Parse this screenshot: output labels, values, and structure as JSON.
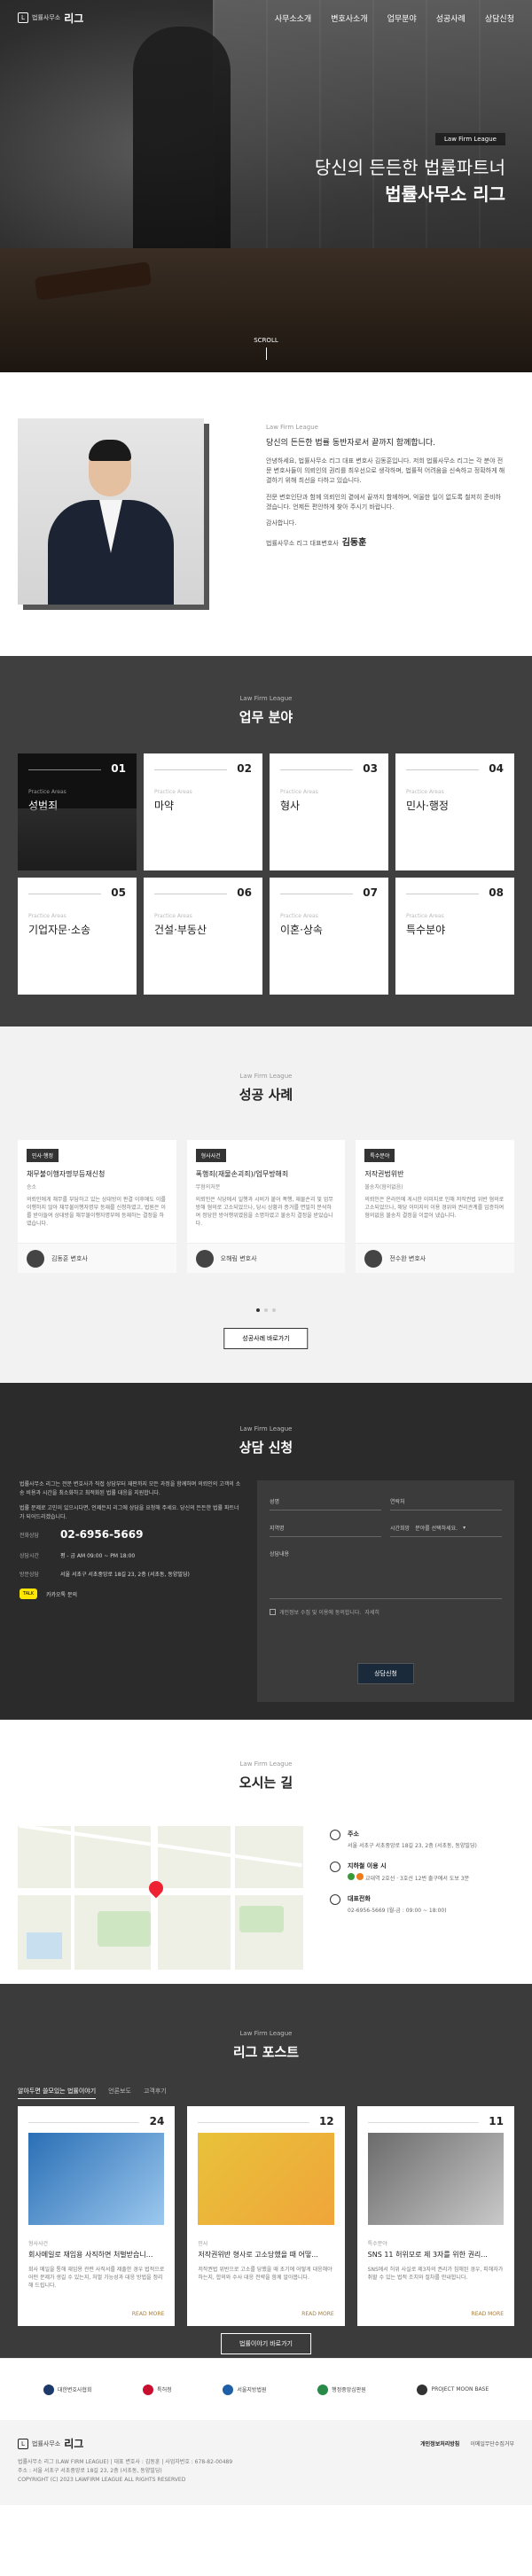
{
  "brand": {
    "sub": "법률사무소",
    "main": "리그",
    "mark": "L"
  },
  "nav": [
    "사무소소개",
    "변호사소개",
    "업무분야",
    "성공사례",
    "상담신청"
  ],
  "hero": {
    "tag": "Law Firm League",
    "line1": "당신의 든든한 법률파트너",
    "line2": "법률사무소 리그",
    "scroll": "SCROLL"
  },
  "greeting": {
    "tag": "Law Firm League",
    "headline": "당신의 든든한 법률 동반자로서 끝까지 함께합니다.",
    "p1": "안녕하세요, 법률사무소 리그 대표 변호사 김동훈입니다. 저희 법률사무소 리그는 각 분야 전문 변호사들이 의뢰인의 권리를 최우선으로 생각하며, 법률적 어려움을 신속하고 정확하게 해결하기 위해 최선을 다하고 있습니다.",
    "p2": "전문 변호인단과 함께 의뢰인의 곁에서 끝까지 함께하며, 억울한 일이 없도록 철저히 준비하겠습니다. 언제든 편안하게 찾아 주시기 바랍니다.",
    "p3": "감사합니다.",
    "sign_label": "법률사무소 리그 대표변호사",
    "sign_name": "김동훈"
  },
  "practice": {
    "tag": "Law Firm League",
    "title": "업무 분야",
    "items": [
      {
        "num": "01",
        "en": "Practice Areas",
        "ko": "성범죄"
      },
      {
        "num": "02",
        "en": "Practice Areas",
        "ko": "마약"
      },
      {
        "num": "03",
        "en": "Practice Areas",
        "ko": "형사"
      },
      {
        "num": "04",
        "en": "Practice Areas",
        "ko": "민사·행정"
      },
      {
        "num": "05",
        "en": "Practice Areas",
        "ko": "기업자문·소송"
      },
      {
        "num": "06",
        "en": "Practice Areas",
        "ko": "건설·부동산"
      },
      {
        "num": "07",
        "en": "Practice Areas",
        "ko": "이혼·상속"
      },
      {
        "num": "08",
        "en": "Practice Areas",
        "ko": "특수분야"
      }
    ]
  },
  "cases": {
    "tag": "Law Firm League",
    "title": "성공 사례",
    "items": [
      {
        "badge": "민사·행정",
        "title": "채무불이행자명부등재신청",
        "cat": "승소",
        "desc": "의뢰인에게 채무를 부담하고 있는 상대방이 판결 이후에도 이를 이행하지 않아 채무불이행자명부 등재를 신청하였고, 법원은 이를 받아들여 상대방을 채무불이행자명부에 등재하는 결정을 하였습니다.",
        "lawyer": "김동훈 변호사"
      },
      {
        "badge": "형사사건",
        "title": "폭행죄(재물손괴죄)/업무방해죄",
        "cat": "무혐의처분",
        "desc": "의뢰인은 식당에서 일행과 시비가 붙어 폭행, 재물손괴 및 업무방해 혐의로 고소되었으나, 당시 상황과 증거를 면밀히 분석하여 정당한 방어행위였음을 소명하였고 불송치 결정을 받았습니다.",
        "lawyer": "오해림 변호사"
      },
      {
        "badge": "특수분야",
        "title": "저작권법위반",
        "cat": "불송치(혐의없음)",
        "desc": "의뢰인은 온라인에 게시한 이미지로 인해 저작권법 위반 혐의로 고소되었으나, 해당 이미지의 이용 경위와 권리관계를 입증하여 혐의없음 불송치 결정을 이끌어 냈습니다.",
        "lawyer": "전수완 변호사"
      }
    ],
    "more": "성공사례 바로가기"
  },
  "consult": {
    "tag": "Law Firm League",
    "title": "상담 신청",
    "p1": "법률사무소 리그는 전문 변호사가 직접 상담부터 재판까지 모든 과정을 함께하며 의뢰인의 고객의 소송 비용과 시간을 최소화하고 최적화된 법률 대응을 지원합니다.",
    "p2": "법률 문제로 고민이 있으시다면, 언제든지 리그에 상담을 요청해 주세요. 당신의 든든한 법률 파트너가 되어드리겠습니다.",
    "phone_label": "전화상담",
    "phone": "02-6956-5669",
    "hours_label": "상담시간",
    "hours": "평 - 금 AM 09:00 ~ PM 18:00",
    "addr_label": "방문상담",
    "addr": "서울 서초구 서초중앙로 18길 23, 2층 (서초동, 동양빌딩)",
    "kakao_label": "카카오톡 문의",
    "kakao_badge": "TALK",
    "form": {
      "name": "성명",
      "contact": "연락처",
      "region": "지역명",
      "time_label": "시간희망",
      "time_select": "분야를 선택하세요.",
      "content": "상담내용",
      "agree": "개인정보 수집 및 이용에 동의합니다.",
      "agree_link": "자세히",
      "submit": "상담신청"
    }
  },
  "location": {
    "tag": "Law Firm League",
    "title": "오시는 길",
    "addr_title": "주소",
    "addr": "서울 서초구 서초중앙로 18길 23, 2층 (서초동, 동양빌딩)",
    "subway_title": "지하철 이용 시",
    "subway": "교대역 2호선 · 3호선 12번 출구에서 도보 3분",
    "phone_title": "대표전화",
    "phone": "02-6956-5669 (월-금 : 09:00 ~ 18:00)"
  },
  "blog": {
    "tag": "Law Firm League",
    "title": "리그 포스트",
    "tabs": [
      "알아두면 쓸모있는 법률이야기",
      "언론보도",
      "고객후기"
    ],
    "posts": [
      {
        "num": "24",
        "tag": "형사사건",
        "title": "회사메일로 재임용 사직하면 처벌받습니...",
        "desc": "회사 메일을 통해 재임용 관련 사직서를 제출한 경우 법적으로 어떤 문제가 생길 수 있는지, 처벌 가능성과 대응 방법을 정리해 드립니다.",
        "read": "READ MORE"
      },
      {
        "num": "12",
        "tag": "민사",
        "title": "저작권위반 형사로 고소당했을 때 어떻...",
        "desc": "저작권법 위반으로 고소를 당했을 때 초기에 어떻게 대응해야 하는지, 합의와 수사 대응 전략을 함께 알아봅니다.",
        "read": "READ MORE"
      },
      {
        "num": "11",
        "tag": "특수분야",
        "title": "SNS 11 허위모로 제 3자를 위한 권리...",
        "desc": "SNS에서 허위 사실로 제3자의 권리가 침해된 경우, 피해자가 취할 수 있는 법적 조치와 절차를 안내합니다.",
        "read": "READ MORE"
      }
    ],
    "more": "법률이야기 바로가기"
  },
  "partners": [
    "대한변호사협회",
    "특허청",
    "서울지방법원",
    "행정중앙심판원",
    "PROJECT MOON BASE"
  ],
  "footer": {
    "line1": "법률사무소 리그 (LAW FIRM LEAGUE) | 대표 변호사 : 김동훈 | 사업자번호 : 678-82-00489",
    "line2": "주소 : 서울 서초구 서초중앙로 18길 23, 2층 (서초동, 동양빌딩)",
    "line3": "COPYRIGHT (C) 2023 LAWFIRM LEAGUE ALL RIGHTS RESERVED",
    "links": [
      "개인정보처리방침",
      "이메일무단수집거부"
    ]
  },
  "colors": {
    "accent": "#a67c3a",
    "dark": "#2b2b2b",
    "kakao": "#ffe600"
  }
}
